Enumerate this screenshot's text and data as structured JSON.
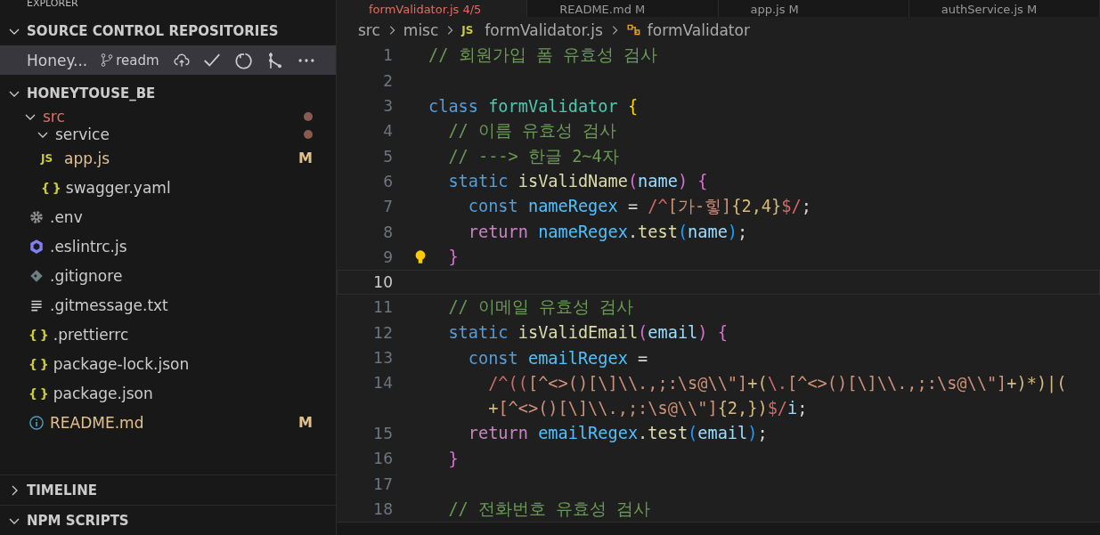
{
  "sidebar": {
    "title": "EXPLORER",
    "scm": {
      "title": "SOURCE CONTROL REPOSITORIES",
      "expanded": true,
      "repo": {
        "name": "Honey...",
        "branch": "readm",
        "selected": true
      }
    },
    "explorer": {
      "title": "HONEYTOUSE_BE",
      "expanded": true,
      "items": [
        {
          "name": "src",
          "kind": "folder",
          "expanded": true,
          "modified": true,
          "color": "#e06c60",
          "children": [
            {
              "name": "service",
              "kind": "folder",
              "expanded": true,
              "modified": true,
              "color": "#cccccc"
            },
            {
              "name": "app.js",
              "kind": "js",
              "icon": "JS",
              "badge": "M",
              "modified": false,
              "color": "#e2c08d"
            },
            {
              "name": "swagger.yaml",
              "kind": "braces",
              "icon": "{ }",
              "modified": false,
              "color": "#cccccc"
            }
          ]
        },
        {
          "name": ".env",
          "kind": "gear",
          "modified": false,
          "color": "#cccccc"
        },
        {
          "name": ".eslintrc.js",
          "kind": "eslint",
          "modified": false,
          "color": "#cccccc"
        },
        {
          "name": ".gitignore",
          "kind": "git",
          "modified": false,
          "color": "#cccccc"
        },
        {
          "name": ".gitmessage.txt",
          "kind": "lines",
          "modified": false,
          "color": "#cccccc"
        },
        {
          "name": ".prettierrc",
          "kind": "braces",
          "icon": "{ }",
          "modified": false,
          "color": "#cccccc"
        },
        {
          "name": "package-lock.json",
          "kind": "braces",
          "icon": "{ }",
          "modified": false,
          "color": "#cccccc"
        },
        {
          "name": "package.json",
          "kind": "braces",
          "icon": "{ }",
          "modified": false,
          "color": "#cccccc"
        },
        {
          "name": "README.md",
          "kind": "info",
          "badge": "M",
          "modified": false,
          "color": "#e2c08d"
        }
      ]
    },
    "sections": [
      {
        "title": "TIMELINE",
        "expanded": false
      },
      {
        "title": "NPM SCRIPTS",
        "expanded": true
      }
    ]
  },
  "tabs": [
    {
      "label": "formValidator.js 4/5",
      "selected": true
    },
    {
      "label": "README.md M",
      "selected": false
    },
    {
      "label": "app.js M",
      "selected": false
    },
    {
      "label": "authService.js M",
      "selected": false
    }
  ],
  "breadcrumbs": [
    {
      "label": "src",
      "kind": "folder"
    },
    {
      "label": "misc",
      "kind": "folder"
    },
    {
      "label": "formValidator.js",
      "kind": "js",
      "icon": "JS"
    },
    {
      "label": "formValidator",
      "kind": "symbol"
    }
  ],
  "editor": {
    "lines": [
      {
        "number": "1",
        "current": false,
        "tokens": [
          {
            "t": "// 회원가입 폼 유효성 검사",
            "kind": "comment"
          }
        ]
      },
      {
        "number": "2",
        "current": false
      },
      {
        "number": "3",
        "current": false,
        "tokens": [
          {
            "t": "class ",
            "kind": "keyword"
          },
          {
            "t": "formValidator ",
            "kind": "type"
          },
          {
            "t": "{",
            "kind": "brace1"
          }
        ]
      },
      {
        "number": "4",
        "current": false,
        "tokens": [
          {
            "t": "  // 이름 유효성 검사",
            "kind": "comment"
          }
        ]
      },
      {
        "number": "5",
        "current": false,
        "tokens": [
          {
            "t": "  // ---> 한글 2~4자",
            "kind": "comment"
          }
        ]
      },
      {
        "number": "6",
        "current": false,
        "tokens": [
          {
            "t": "  static ",
            "kind": "keyword"
          },
          {
            "t": "isValidName",
            "kind": "func"
          },
          {
            "t": "(",
            "kind": "brace2"
          },
          {
            "t": "name",
            "kind": "var"
          },
          {
            "t": ") {",
            "kind": "brace2"
          }
        ]
      },
      {
        "number": "7",
        "current": false,
        "tokens": [
          {
            "t": "    const ",
            "kind": "keyword"
          },
          {
            "t": "nameRegex",
            "kind": "const"
          },
          {
            "t": " = ",
            "kind": "plain"
          },
          {
            "t": "/^",
            "kind": "regex"
          },
          {
            "t": "[가-힣]",
            "kind": "regexset"
          },
          {
            "t": "{2,4}",
            "kind": "regexq"
          },
          {
            "t": "$/",
            "kind": "regex"
          },
          {
            "t": ";",
            "kind": "plain"
          }
        ]
      },
      {
        "number": "8",
        "current": false,
        "tokens": [
          {
            "t": "    return ",
            "kind": "control"
          },
          {
            "t": "nameRegex",
            "kind": "const"
          },
          {
            "t": ".",
            "kind": "plain"
          },
          {
            "t": "test",
            "kind": "func"
          },
          {
            "t": "(",
            "kind": "brace3"
          },
          {
            "t": "name",
            "kind": "var"
          },
          {
            "t": ")",
            "kind": "brace3"
          },
          {
            "t": ";",
            "kind": "plain"
          }
        ]
      },
      {
        "number": "9",
        "current": false,
        "bulb": true,
        "tokens": [
          {
            "t": "  }",
            "kind": "brace2"
          }
        ]
      },
      {
        "number": "10",
        "current": true
      },
      {
        "number": "11",
        "current": false,
        "tokens": [
          {
            "t": "  // 이메일 유효성 검사",
            "kind": "comment"
          }
        ]
      },
      {
        "number": "12",
        "current": false,
        "tokens": [
          {
            "t": "  static ",
            "kind": "keyword"
          },
          {
            "t": "isValidEmail",
            "kind": "func"
          },
          {
            "t": "(",
            "kind": "brace2"
          },
          {
            "t": "email",
            "kind": "var"
          },
          {
            "t": ") {",
            "kind": "brace2"
          }
        ]
      },
      {
        "number": "13",
        "current": false,
        "tokens": [
          {
            "t": "    const ",
            "kind": "keyword"
          },
          {
            "t": "emailRegex",
            "kind": "const"
          },
          {
            "t": " =",
            "kind": "plain"
          }
        ]
      },
      {
        "number": "14",
        "current": false,
        "tokens": [
          {
            "t": "      /^((",
            "kind": "regex"
          },
          {
            "t": "[^<>()[\\]\\\\.,;:\\s@\\\\\"]",
            "kind": "regexset"
          },
          {
            "t": "+(",
            "kind": "regexq"
          },
          {
            "t": "\\.",
            "kind": "regex"
          },
          {
            "t": "[^<>()[\\]\\\\.,;:\\s@\\\\\"]",
            "kind": "regexset"
          },
          {
            "t": "+)*)|(",
            "kind": "regexq"
          }
        ]
      },
      {
        "current": false,
        "tokens": [
          {
            "t": "      +",
            "kind": "regexq"
          },
          {
            "t": "[^<>()[\\]\\\\.,;:\\s@\\\\\"]",
            "kind": "regexset"
          },
          {
            "t": "{2,})",
            "kind": "regexq"
          },
          {
            "t": "$/",
            "kind": "regex"
          },
          {
            "t": "i",
            "kind": "var"
          },
          {
            "t": ";",
            "kind": "plain"
          }
        ]
      },
      {
        "number": "15",
        "current": false,
        "tokens": [
          {
            "t": "    return ",
            "kind": "control"
          },
          {
            "t": "emailRegex",
            "kind": "const"
          },
          {
            "t": ".",
            "kind": "plain"
          },
          {
            "t": "test",
            "kind": "func"
          },
          {
            "t": "(",
            "kind": "brace3"
          },
          {
            "t": "email",
            "kind": "var"
          },
          {
            "t": ")",
            "kind": "brace3"
          },
          {
            "t": ";",
            "kind": "plain"
          }
        ]
      },
      {
        "number": "16",
        "current": false,
        "tokens": [
          {
            "t": "  }",
            "kind": "brace2"
          }
        ]
      },
      {
        "number": "17",
        "current": false
      },
      {
        "number": "18",
        "current": false,
        "tokens": [
          {
            "t": "  // 전화번호 유효성 검사",
            "kind": "comment"
          }
        ]
      }
    ]
  }
}
